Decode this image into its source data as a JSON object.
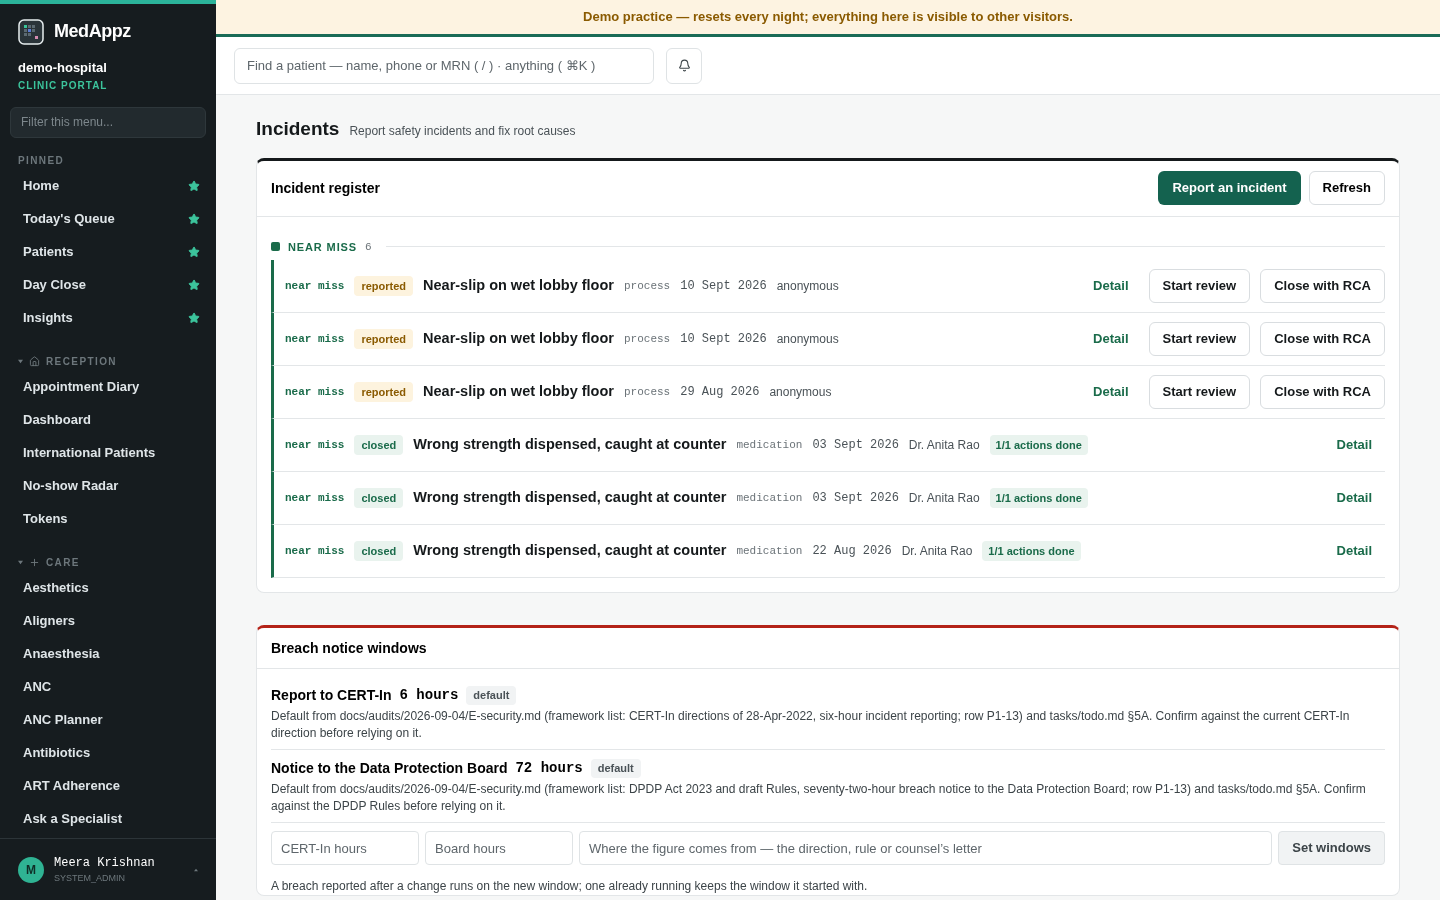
{
  "brand": {
    "name": "MedAppz",
    "tenant": "demo-hospital",
    "portal": "CLINIC PORTAL"
  },
  "sidebar": {
    "filter_placeholder": "Filter this menu...",
    "sections": [
      {
        "title": "PINNED",
        "kind": "plain",
        "items": [
          {
            "label": "Home",
            "pinned": true
          },
          {
            "label": "Today's Queue",
            "pinned": true
          },
          {
            "label": "Patients",
            "pinned": true
          },
          {
            "label": "Day Close",
            "pinned": true
          },
          {
            "label": "Insights",
            "pinned": true
          }
        ]
      },
      {
        "title": "RECEPTION",
        "kind": "home",
        "expanded": true,
        "items": [
          {
            "label": "Appointment Diary",
            "pinned": false
          },
          {
            "label": "Dashboard",
            "pinned": false
          },
          {
            "label": "International Patients",
            "pinned": false
          },
          {
            "label": "No-show Radar",
            "pinned": false
          },
          {
            "label": "Tokens",
            "pinned": false
          }
        ]
      },
      {
        "title": "CARE",
        "kind": "plus",
        "expanded": true,
        "items": [
          {
            "label": "Aesthetics",
            "pinned": false
          },
          {
            "label": "Aligners",
            "pinned": false
          },
          {
            "label": "Anaesthesia",
            "pinned": false
          },
          {
            "label": "ANC",
            "pinned": false
          },
          {
            "label": "ANC Planner",
            "pinned": false
          },
          {
            "label": "Antibiotics",
            "pinned": false
          },
          {
            "label": "ART Adherence",
            "pinned": false
          },
          {
            "label": "Ask a Specialist",
            "pinned": false
          }
        ]
      }
    ],
    "user": {
      "initial": "M",
      "name": "Meera Krishnan",
      "role": "SYSTEM_ADMIN"
    }
  },
  "banner": "Demo practice — resets every night; everything here is visible to other visitors.",
  "search": {
    "placeholder": "Find a patient — name, phone or MRN ( / ) · anything ( ⌘K )"
  },
  "page": {
    "title": "Incidents",
    "subtitle": "Report safety incidents and fix root causes"
  },
  "register": {
    "title": "Incident register",
    "buttons": [
      "Report an incident",
      "Refresh"
    ],
    "group": {
      "label": "NEAR MISS",
      "count": "6",
      "color": "#1a6b4a"
    },
    "rows": [
      {
        "kind": "open",
        "type": "near miss",
        "status": "reported",
        "title": "Near-slip on wet lobby floor",
        "category": "process",
        "date": "10 Sept 2026",
        "reporter": "anonymous",
        "actions": [
          "Detail",
          "Start review",
          "Close with RCA"
        ]
      },
      {
        "kind": "open",
        "type": "near miss",
        "status": "reported",
        "title": "Near-slip on wet lobby floor",
        "category": "process",
        "date": "10 Sept 2026",
        "reporter": "anonymous",
        "actions": [
          "Detail",
          "Start review",
          "Close with RCA"
        ]
      },
      {
        "kind": "open",
        "type": "near miss",
        "status": "reported",
        "title": "Near-slip on wet lobby floor",
        "category": "process",
        "date": "29 Aug 2026",
        "reporter": "anonymous",
        "actions": [
          "Detail",
          "Start review",
          "Close with RCA"
        ]
      },
      {
        "kind": "closed",
        "type": "near miss",
        "status": "closed",
        "title": "Wrong strength dispensed, caught at counter",
        "category": "medication",
        "date": "03 Sept 2026",
        "reporter": "Dr. Anita Rao",
        "progress": "1/1 actions done",
        "actions": [
          "Detail"
        ]
      },
      {
        "kind": "closed",
        "type": "near miss",
        "status": "closed",
        "title": "Wrong strength dispensed, caught at counter",
        "category": "medication",
        "date": "03 Sept 2026",
        "reporter": "Dr. Anita Rao",
        "progress": "1/1 actions done",
        "actions": [
          "Detail"
        ]
      },
      {
        "kind": "closed",
        "type": "near miss",
        "status": "closed",
        "title": "Wrong strength dispensed, caught at counter",
        "category": "medication",
        "date": "22 Aug 2026",
        "reporter": "Dr. Anita Rao",
        "progress": "1/1 actions done",
        "actions": [
          "Detail"
        ]
      }
    ]
  },
  "breach": {
    "title": "Breach notice windows",
    "windows": [
      {
        "name": "Report to CERT-In",
        "value": "6 hours",
        "tag": "default",
        "note": "Default from docs/audits/2026-09-04/E-security.md (framework list: CERT-In directions of 28-Apr-2022, six-hour incident reporting; row P1-13) and tasks/todo.md §5A. Confirm against the current CERT-In direction before relying on it."
      },
      {
        "name": "Notice to the Data Protection Board",
        "value": "72 hours",
        "tag": "default",
        "note": "Default from docs/audits/2026-09-04/E-security.md (framework list: DPDP Act 2023 and draft Rules, seventy-two-hour breach notice to the Data Protection Board; row P1-13) and tasks/todo.md §5A. Confirm against the DPDP Rules before relying on it."
      }
    ],
    "fields": [
      {
        "placeholder": "CERT-In hours"
      },
      {
        "placeholder": "Board hours"
      },
      {
        "placeholder": "Where the figure comes from — the direction, rule or counsel’s letter"
      }
    ],
    "button": "Set windows",
    "footnote": "A breach reported after a change runs on the new window; one already running keeps the window it started with."
  }
}
